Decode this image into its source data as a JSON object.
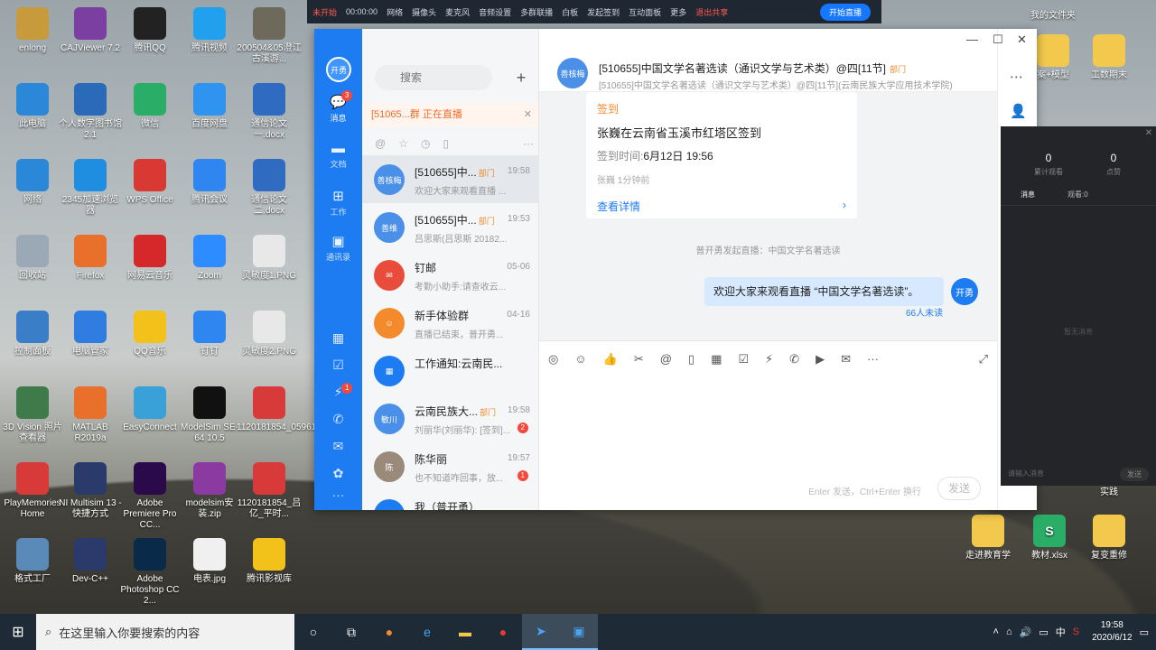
{
  "desktop_icons": [
    {
      "label": "enlong",
      "color": "#c79a3b"
    },
    {
      "label": "CAJViewer 7.2",
      "color": "#7a3fa0"
    },
    {
      "label": "腾讯QQ",
      "color": "#222222"
    },
    {
      "label": "腾讯视频",
      "color": "#22a0f0"
    },
    {
      "label": "200504&05澄江古溪游...",
      "color": "#6d6a5c"
    },
    {
      "label": "此电脑",
      "color": "#2b87d8"
    },
    {
      "label": "个人数字图书馆2.1",
      "color": "#2a6ab8"
    },
    {
      "label": "微信",
      "color": "#2aae67"
    },
    {
      "label": "百度网盘",
      "color": "#2f93f0"
    },
    {
      "label": "通信论文一.docx",
      "color": "#2f6bc0"
    },
    {
      "label": "网络",
      "color": "#2b87d8"
    },
    {
      "label": "2345加速浏览器",
      "color": "#1f8de0"
    },
    {
      "label": "WPS Office",
      "color": "#d83a33"
    },
    {
      "label": "腾讯会议",
      "color": "#2f86f0"
    },
    {
      "label": "通信论文二.docx",
      "color": "#2f6bc0"
    },
    {
      "label": "回收站",
      "color": "#9aa9b5"
    },
    {
      "label": "Firefox",
      "color": "#e8702a"
    },
    {
      "label": "网易云音乐",
      "color": "#d4282a"
    },
    {
      "label": "Zoom",
      "color": "#2d8cff"
    },
    {
      "label": "灵敏度1.PNG",
      "color": "#e8e8e8"
    },
    {
      "label": "控制面板",
      "color": "#3a7ec8"
    },
    {
      "label": "电脑管家",
      "color": "#2f7de0"
    },
    {
      "label": "QQ音乐",
      "color": "#f2c21b"
    },
    {
      "label": "钉钉",
      "color": "#2f86f0"
    },
    {
      "label": "灵敏度2.PNG",
      "color": "#e8e8e8"
    },
    {
      "label": "3D Vision 照片查看器",
      "color": "#3e7a4a"
    },
    {
      "label": "MATLAB R2019a",
      "color": "#e8702a"
    },
    {
      "label": "EasyConnect",
      "color": "#3aa0d8"
    },
    {
      "label": "ModelSim SE-64 10.5",
      "color": "#111111"
    },
    {
      "label": "1120181854_05961801...",
      "color": "#d83a3a"
    },
    {
      "label": "PlayMemories Home",
      "color": "#d83a3a"
    },
    {
      "label": "NI Multisim 13 - 快捷方式",
      "color": "#2a3a6a"
    },
    {
      "label": "Adobe Premiere Pro CC...",
      "color": "#2a0a4a"
    },
    {
      "label": "modelsim安装.zip",
      "color": "#8a3aa0"
    },
    {
      "label": "1120181854_吕亿_平时...",
      "color": "#d83a3a"
    },
    {
      "label": "格式工厂",
      "color": "#5a8ab8"
    },
    {
      "label": "Dev-C++",
      "color": "#2a3a6a"
    },
    {
      "label": "Adobe Photoshop CC 2...",
      "color": "#0a2a4a"
    },
    {
      "label": "电表.jpg",
      "color": "#f0f0f0"
    },
    {
      "label": "腾讯影视库",
      "color": "#f2c21b"
    }
  ],
  "right_desktop_icons": [
    {
      "label": "我的文件夹"
    },
    {
      "label": "案+模型"
    },
    {
      "label": "工数期末"
    },
    {
      "label": "实践"
    },
    {
      "label": "走进教育学"
    },
    {
      "label": "教材.xlsx"
    },
    {
      "label": "复变重修"
    }
  ],
  "live_bar": {
    "status": "未开始",
    "timer": "00:00:00",
    "items": [
      "网络",
      "摄像头",
      "麦克风",
      "音频设置",
      "多群联播",
      "白板",
      "发起签到",
      "互动面板",
      "更多",
      "退出共享"
    ],
    "start_label": "开始直播"
  },
  "nav": {
    "avatar": "开勇",
    "items": [
      {
        "label": "消息",
        "badge": "3"
      },
      {
        "label": "文档"
      },
      {
        "label": "工作"
      },
      {
        "label": "通讯录"
      }
    ],
    "bottom_badge": "1",
    "more": "···"
  },
  "list": {
    "search_placeholder": "搜索",
    "add": "+",
    "live_notice": "[51065...群 正在直播",
    "conversations": [
      {
        "name": "[510655]中...",
        "tag": "部门",
        "time": "19:58",
        "preview": "欢迎大家来观看直播 ...",
        "avatar": "善核梅",
        "color": "#4a8fe8"
      },
      {
        "name": "[510655]中...",
        "tag": "部门",
        "time": "19:53",
        "preview": "吕思斯(吕思斯 20182...",
        "avatar": "善维",
        "color": "#4a8fe8"
      },
      {
        "name": "钉邮",
        "tag": "",
        "time": "05-06",
        "preview": "考勤小助手:请查收云...",
        "avatar": "✉",
        "color": "#ea4c3c"
      },
      {
        "name": "新手体验群",
        "tag": "",
        "time": "04-16",
        "preview": "直播已结束，普开勇...",
        "avatar": "☺",
        "color": "#f38a2b"
      },
      {
        "name": "工作通知:云南民...",
        "tag": "",
        "time": "",
        "preview": "",
        "avatar": "▦",
        "color": "#1d7cf2"
      },
      {
        "name": "云南民族大...",
        "tag": "部门",
        "time": "19:58",
        "preview": "刘丽华(刘丽华): [签到]...",
        "avatar": "敏川",
        "color": "#4a8fe8",
        "unread": "2"
      },
      {
        "name": "陈华丽",
        "tag": "",
        "time": "19:57",
        "preview": "也不知道咋回事，放...",
        "avatar": "陈",
        "color": "#9a8a7a",
        "unread": "1"
      },
      {
        "name": "我（普开勇）",
        "tag": "",
        "time": "",
        "preview": "",
        "avatar": "我",
        "color": "#1d7cf2"
      }
    ]
  },
  "chat": {
    "title": "[510655]中国文学名著选读（通识文学与艺术类）@四[11节]",
    "title_tag": "部门",
    "subtitle": "[510655]中国文学名著选读（通识文学与艺术类）@四[11节](云南民族大学应用技术学院)",
    "avatar": "善核梅",
    "card": {
      "type": "签到",
      "headline": "张巍在云南省玉溪市红塔区签到",
      "time_label": "签到时间:",
      "time_value": "6月12日 19:56",
      "meta": "张巍 1分钟前",
      "link": "查看详情"
    },
    "system_note": "普开勇发起直播：中国文学名著选读",
    "my_message": "欢迎大家来观看直播 “中国文学名著选读”。",
    "my_avatar": "开勇",
    "read_count": "66人未读",
    "composer_hint": "Enter 发送，Ctrl+Enter 换行",
    "send_label": "发送"
  },
  "side_panel": {
    "stats": [
      {
        "value": "0",
        "label": "累计观看"
      },
      {
        "value": "0",
        "label": "点赞"
      }
    ],
    "tabs": [
      "消息",
      "观看:0"
    ],
    "empty": "暂无消息",
    "input_placeholder": "请输入消息",
    "send": "发送"
  },
  "taskbar": {
    "search_placeholder": "在这里输入你要搜索的内容",
    "time": "19:58",
    "date": "2020/6/12"
  }
}
